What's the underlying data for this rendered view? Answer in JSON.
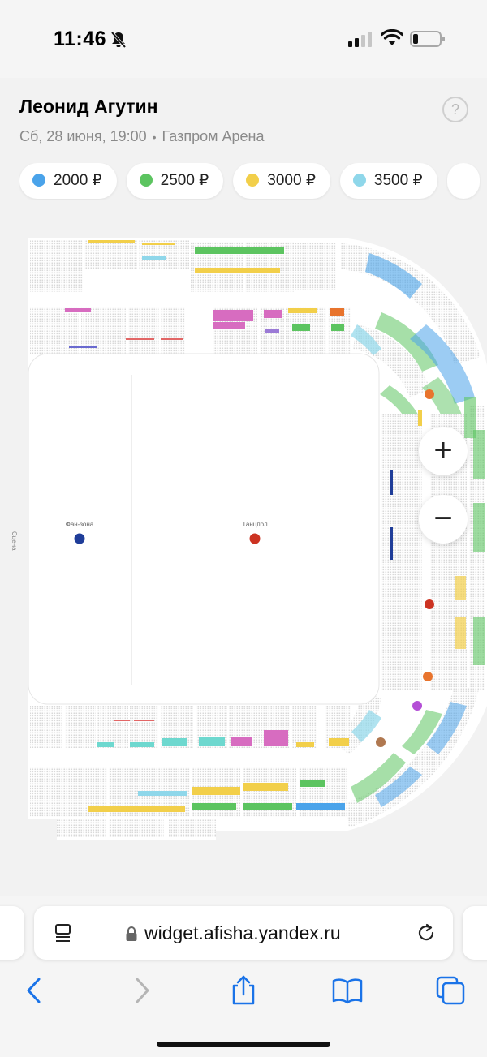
{
  "status_bar": {
    "time": "11:46"
  },
  "event": {
    "title": "Леонид Агутин",
    "date": "Сб, 28 июня, 19:00",
    "separator": "•",
    "venue": "Газпром Арена",
    "help": "?"
  },
  "prices": [
    {
      "label": "2000 ₽",
      "color": "#4aa3ea"
    },
    {
      "label": "2500 ₽",
      "color": "#5cc460"
    },
    {
      "label": "3000 ₽",
      "color": "#f2cf4a"
    },
    {
      "label": "3500 ₽",
      "color": "#8fd7ea"
    }
  ],
  "map": {
    "stage_label": "Сцена",
    "fan_zone_label": "Фан-зона",
    "dance_floor_label": "Танцпол",
    "zoom_in": "+",
    "zoom_out": "−",
    "colors": {
      "fan_zone": "#1f3d99",
      "dance_floor": "#cc3322",
      "orange": "#e8742d",
      "purple": "#b44fd6",
      "brown": "#b07850",
      "pink": "#d76cc0",
      "lavender": "#9b7ad6",
      "teal": "#6ed8cf",
      "green": "#5cc460",
      "yellow": "#f2cf4a",
      "blue": "#4aa3ea"
    }
  },
  "browser": {
    "url": "widget.afisha.yandex.ru"
  }
}
